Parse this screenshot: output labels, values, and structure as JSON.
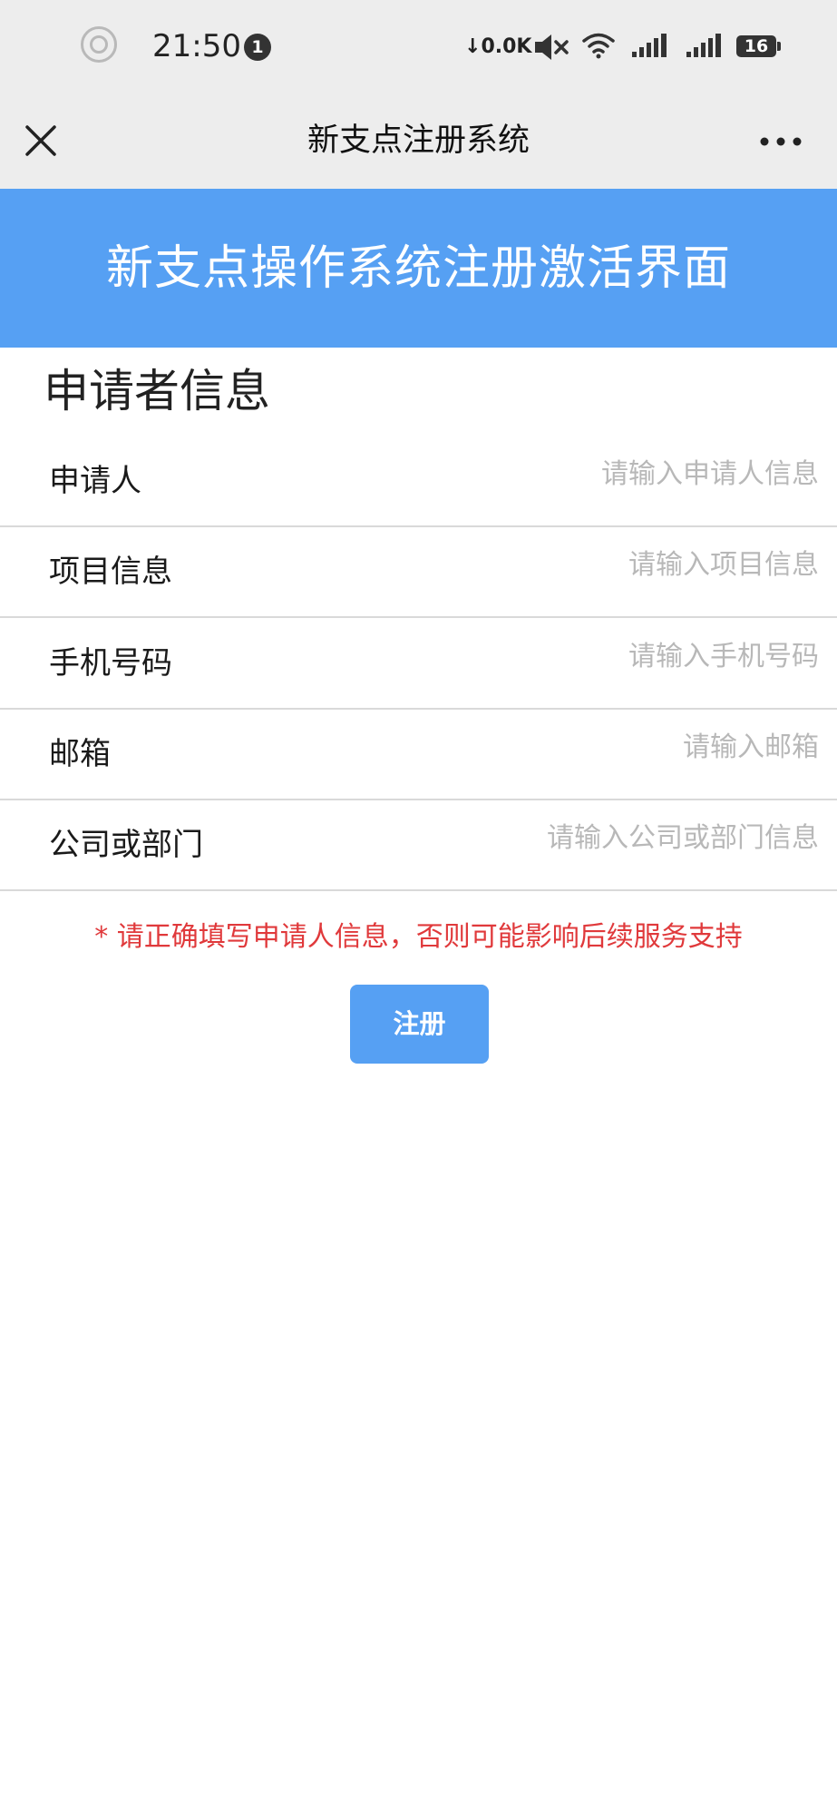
{
  "status_bar": {
    "time": "21:50",
    "notification_count": "1",
    "net_speed": "0.0K",
    "battery": "16",
    "icons": [
      "circle-icon",
      "mute-icon",
      "wifi-icon",
      "signal-icon",
      "signal-2-icon",
      "battery-icon"
    ]
  },
  "nav": {
    "title": "新支点注册系统",
    "close_icon": "close-icon",
    "more_icon": "more-icon"
  },
  "banner": {
    "title": "新支点操作系统注册激活界面",
    "color": "#56a0f3"
  },
  "form": {
    "section_title": "申请者信息",
    "fields": [
      {
        "label": "申请人",
        "value": "",
        "placeholder": "请输入申请人信息"
      },
      {
        "label": "项目信息",
        "value": "",
        "placeholder": "请输入项目信息"
      },
      {
        "label": "手机号码",
        "value": "",
        "placeholder": "请输入手机号码"
      },
      {
        "label": "邮箱",
        "value": "",
        "placeholder": "请输入邮箱"
      },
      {
        "label": "公司或部门",
        "value": "",
        "placeholder": "请输入公司或部门信息"
      }
    ],
    "warning": "* 请正确填写申请人信息，否则可能影响后续服务支持",
    "warning_color": "#e0393b",
    "submit_label": "注册"
  }
}
